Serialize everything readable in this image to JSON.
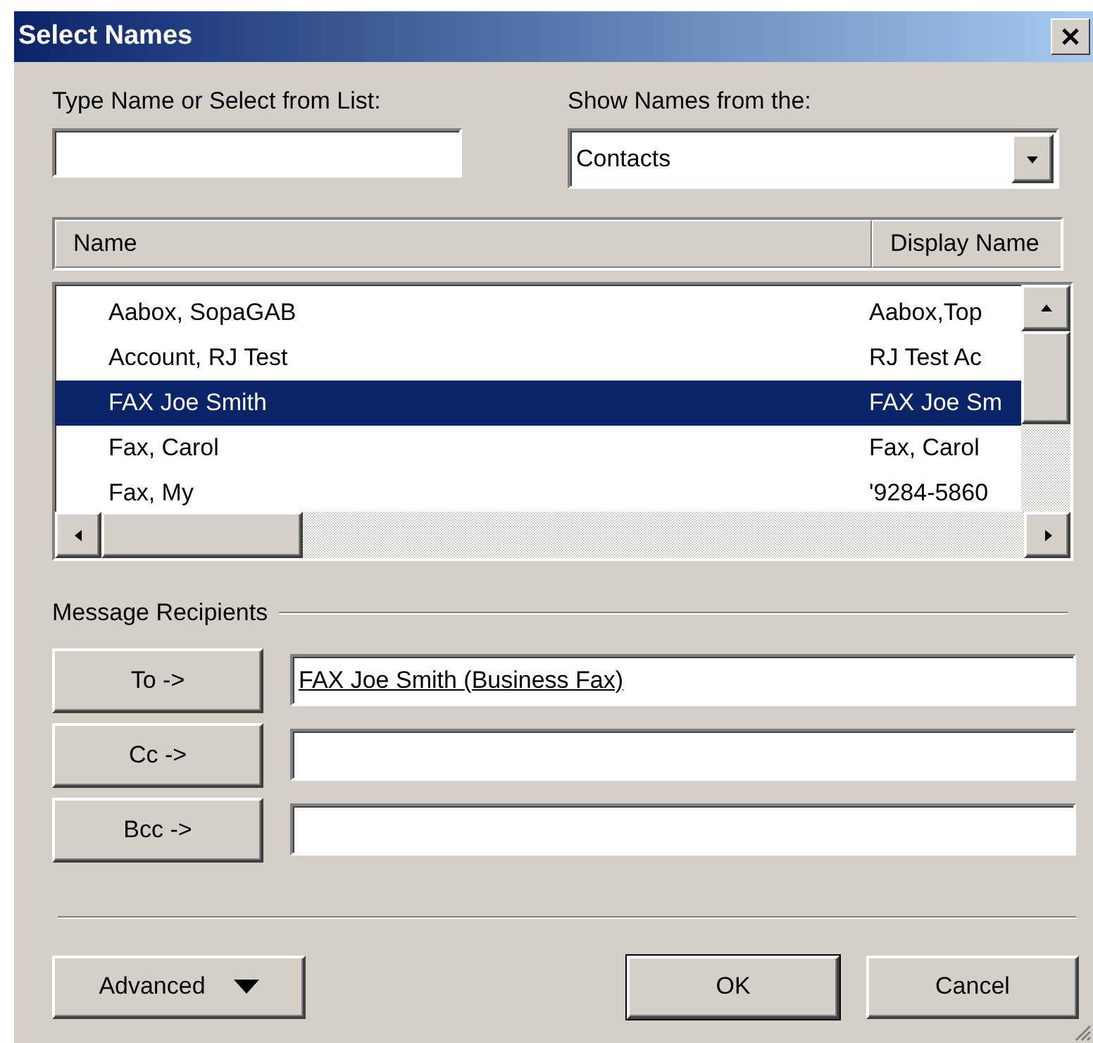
{
  "window": {
    "title": "Select Names"
  },
  "search": {
    "label": "Type Name or Select from List:"
  },
  "source": {
    "label": "Show Names from the:",
    "value": "Contacts"
  },
  "columns": [
    "Name",
    "Display Name"
  ],
  "rows": [
    {
      "name": "Aabox, SopaGAB",
      "display": "Aabox,Top",
      "selected": false
    },
    {
      "name": "Account, RJ Test",
      "display": "RJ Test Ac",
      "selected": false
    },
    {
      "name": "FAX Joe Smith",
      "display": "FAX Joe Sm",
      "selected": true
    },
    {
      "name": "Fax, Carol",
      "display": "Fax, Carol",
      "selected": false
    },
    {
      "name": "Fax, My",
      "display": "'9284-5860",
      "selected": false
    }
  ],
  "recipients": {
    "label": "Message Recipients",
    "fields": [
      {
        "button": "To ->",
        "value": "FAX Joe Smith (Business Fax)",
        "resolved": true
      },
      {
        "button": "Cc ->"
      },
      {
        "button": "Bcc ->"
      }
    ]
  },
  "buttons": [
    {
      "label": "Advanced",
      "kind": "menu"
    },
    {
      "label": "OK",
      "kind": "default"
    },
    {
      "label": "Cancel",
      "kind": "normal"
    }
  ]
}
